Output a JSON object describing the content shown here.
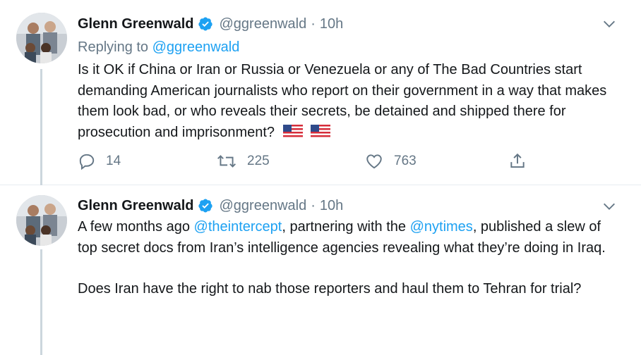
{
  "tweets": [
    {
      "author": {
        "name": "Glenn Greenwald",
        "handle": "@ggreenwald",
        "separator": "·",
        "time": "10h"
      },
      "replying_prefix": "Replying to",
      "replying_to": "@ggreenwald",
      "text": "Is it OK if China or Iran or Russia or Venezuela or any of The Bad Countries start demanding American journalists who report on their government in a way that makes them look bad, or who reveals their secrets, be detained and shipped there for prosecution and imprisonment?",
      "emoji": [
        "us-flag",
        "us-flag"
      ],
      "stats": {
        "replies": "14",
        "retweets": "225",
        "likes": "763"
      }
    },
    {
      "author": {
        "name": "Glenn Greenwald",
        "handle": "@ggreenwald",
        "separator": "·",
        "time": "10h"
      },
      "text_parts": {
        "p1_a": "A few months ago ",
        "mention1": "@theintercept",
        "p1_b": ", partnering with the ",
        "mention2": "@nytimes",
        "p1_c": ", published a slew of top secret docs from Iran’s intelligence agencies revealing what they’re doing in Iraq.",
        "p2": "Does Iran have the right to nab those reporters and haul them to Tehran for trial?"
      }
    }
  ],
  "colors": {
    "link": "#1da1f2",
    "muted": "#657786",
    "text": "#14171a",
    "verified": "#1da1f2"
  }
}
